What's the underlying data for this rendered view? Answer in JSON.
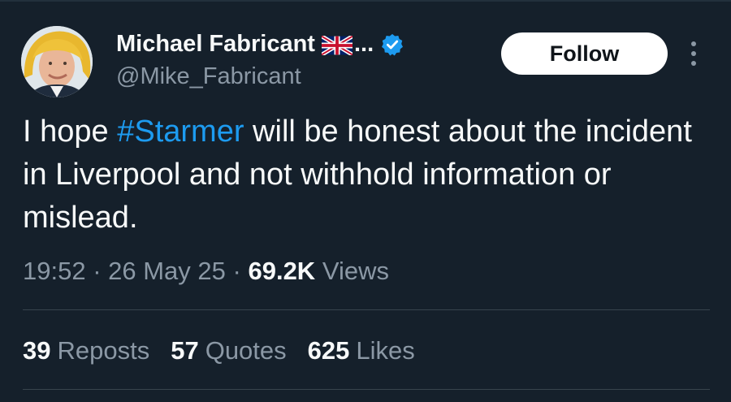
{
  "author": {
    "display_name": "Michael Fabricant",
    "name_truncation": "...",
    "handle": "@Mike_Fabricant",
    "flag_icon": "uk-flag-icon",
    "verified_icon": "verified-badge-icon",
    "verified_color": "#1d9bf0"
  },
  "follow": {
    "label": "Follow"
  },
  "more": {
    "icon": "more-vertical-icon"
  },
  "tweet": {
    "text_before": "I hope ",
    "hashtag": "#Starmer",
    "text_after": " will be honest about the incident in Liverpool and not withhold information or mislead."
  },
  "meta": {
    "time": "19:52",
    "separator": " · ",
    "date": "26 May 25",
    "views_count": "69.2K",
    "views_label": "Views"
  },
  "stats": {
    "reposts_count": "39",
    "reposts_label": "Reposts",
    "quotes_count": "57",
    "quotes_label": "Quotes",
    "likes_count": "625",
    "likes_label": "Likes"
  },
  "colors": {
    "background": "#15202b",
    "accent": "#1d9bf0",
    "primary_text": "#f7f9f9",
    "secondary_text": "#8b98a5"
  }
}
